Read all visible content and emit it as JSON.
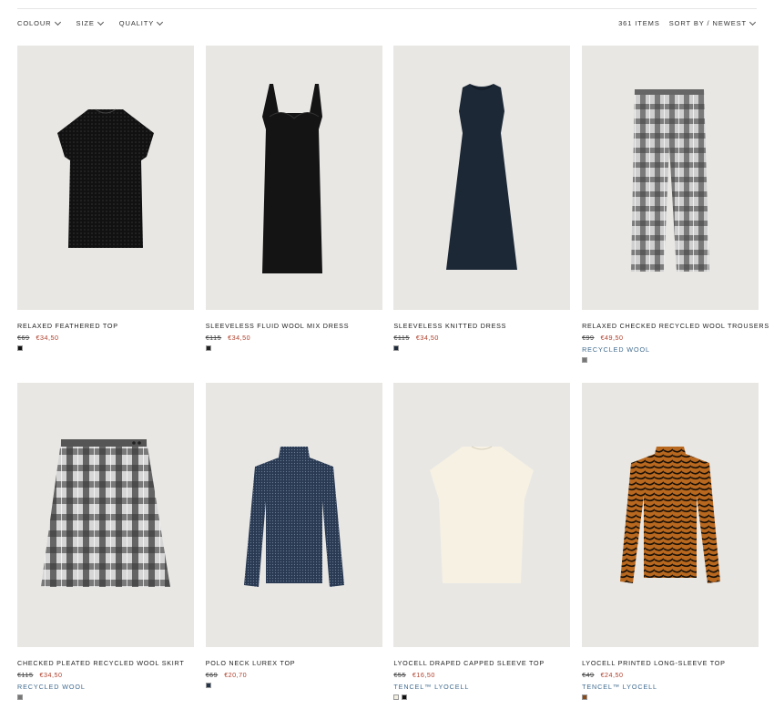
{
  "filters": {
    "colour": "COLOUR",
    "size": "SIZE",
    "quality": "QUALITY",
    "items_count": "361 ITEMS",
    "sort": "SORT BY / NEWEST"
  },
  "products": [
    {
      "name": "RELAXED FEATHERED TOP",
      "old_price": "€69",
      "new_price": "€34,50",
      "quality": "",
      "swatches": [
        "#111111"
      ]
    },
    {
      "name": "SLEEVELESS FLUID WOOL MIX DRESS",
      "old_price": "€115",
      "new_price": "€34,50",
      "quality": "",
      "swatches": [
        "#222222"
      ]
    },
    {
      "name": "SLEEVELESS KNITTED DRESS",
      "old_price": "€115",
      "new_price": "€34,50",
      "quality": "",
      "swatches": [
        "#1f2b3a"
      ]
    },
    {
      "name": "RELAXED CHECKED RECYCLED WOOL TROUSERS",
      "old_price": "€99",
      "new_price": "€49,50",
      "quality": "RECYCLED WOOL",
      "swatches": [
        "#777777"
      ]
    },
    {
      "name": "CHECKED PLEATED RECYCLED WOOL SKIRT",
      "old_price": "€115",
      "new_price": "€34,50",
      "quality": "RECYCLED WOOL",
      "swatches": [
        "#777777"
      ]
    },
    {
      "name": "POLO NECK LUREX TOP",
      "old_price": "€69",
      "new_price": "€20,70",
      "quality": "",
      "swatches": [
        "#243449"
      ]
    },
    {
      "name": "LYOCELL DRAPED CAPPED SLEEVE TOP",
      "old_price": "€55",
      "new_price": "€16,50",
      "quality": "TENCEL™ LYOCELL",
      "swatches": [
        "#f3eee0",
        "#111111"
      ]
    },
    {
      "name": "LYOCELL PRINTED LONG-SLEEVE TOP",
      "old_price": "€49",
      "new_price": "€24,50",
      "quality": "TENCEL™ LYOCELL",
      "swatches": [
        "#8a4a18"
      ]
    }
  ]
}
